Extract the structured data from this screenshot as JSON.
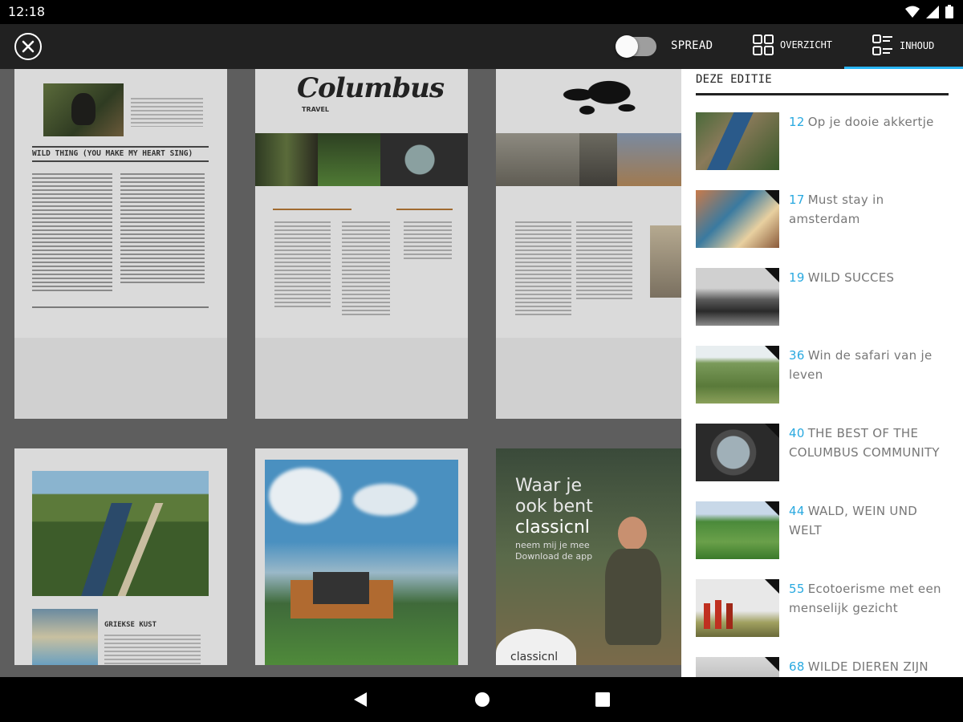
{
  "status_bar": {
    "time": "12:18"
  },
  "toolbar": {
    "spread_label": "SPREAD",
    "overzicht_label": "OVERZICHT",
    "inhoud_label": "INHOUD",
    "accent_color": "#29b6f6"
  },
  "pages": {
    "wild_thing_title": "WILD THING (YOU MAKE MY HEART SING)",
    "columbus_logo": "Columbus",
    "columbus_sub": "TRAVEL",
    "griekse_title": "GRIEKSE KUST",
    "ad_headline_1": "Waar je",
    "ad_headline_2": "ook bent",
    "ad_brand": "classicnl",
    "ad_line_1": "neem mij je mee",
    "ad_line_2": "Download de app",
    "ad_brand_bottom": "classicnl"
  },
  "panel": {
    "header": "DEZE EDITIE",
    "items": [
      {
        "page": "12",
        "title": "Op je dooie akkertje"
      },
      {
        "page": "17",
        "title": "Must stay in amsterdam"
      },
      {
        "page": "19",
        "title": "WILD SUCCES"
      },
      {
        "page": "36",
        "title": "Win de safari van je leven"
      },
      {
        "page": "40",
        "title": "THE BEST OF THE COLUMBUS COMMUNITY"
      },
      {
        "page": "44",
        "title": "WALD, WEIN UND WELT"
      },
      {
        "page": "55",
        "title": "Ecotoerisme met een menselijk gezicht"
      },
      {
        "page": "68",
        "title": "WILDE DIEREN ZIJN"
      }
    ]
  }
}
